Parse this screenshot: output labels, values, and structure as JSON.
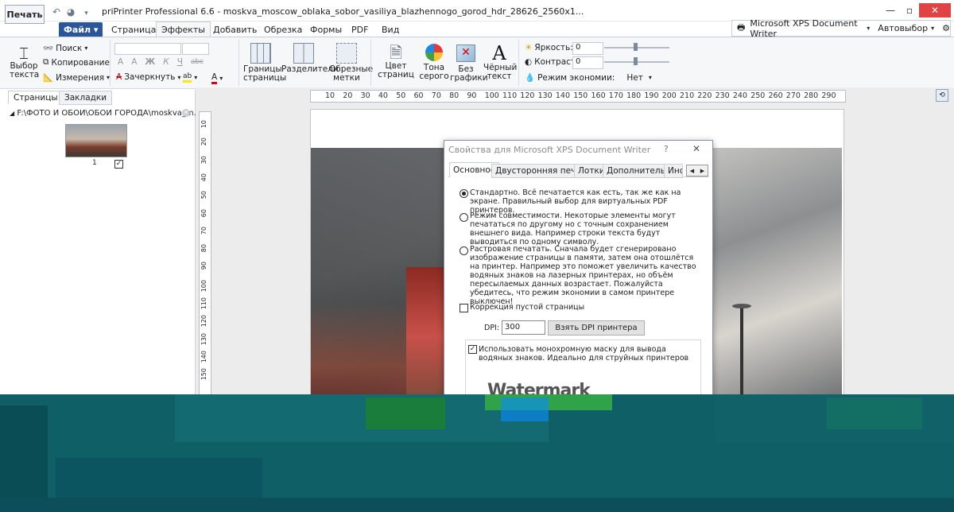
{
  "titlebar": {
    "print_label": "Печать",
    "title": "priPrinter Professional 6.6 - moskva_moscow_oblaka_sobor_vasiliya_blazhennogo_gorod_hdr_28626_2560x1...",
    "qat_icons": [
      "undo-icon",
      "redo-icon",
      "customize-icon"
    ],
    "window_controls": [
      "—",
      "▫",
      "✕"
    ]
  },
  "menu": {
    "file": "Файл ▾",
    "tabs": [
      "Страница",
      "Эффекты",
      "Добавить",
      "Обрезка",
      "Формы",
      "PDF",
      "Вид"
    ],
    "active_index": 1
  },
  "printer": {
    "name": "Microsoft XPS Document Writer",
    "mode": "Автовыбор",
    "gear": "⚙"
  },
  "ribbon": {
    "select_text": "Выбор\nтекста",
    "search": "Поиск",
    "copy": "Копирование",
    "measure": "Измерения",
    "strike": "Зачеркнуть",
    "font_buttons": [
      "A",
      "A",
      "Ж",
      "К",
      "Ч",
      "abc"
    ],
    "page_borders": "Границы\nстраницы",
    "dividers": "Разделители",
    "crop_marks": "Обрезные\nметки",
    "color_pages": "Цвет\nстраниц",
    "grayscale": "Тона\nсерого",
    "no_graphics": "Без\nграфики",
    "black_text": "Чёрный\nтекст",
    "brightness_label": "Яркость:",
    "brightness_value": "0",
    "contrast_label": "Контраст:",
    "contrast_value": "0",
    "economy_label": "Режим экономии:",
    "economy_value": "Нет"
  },
  "left_panel": {
    "tabs": [
      "Страницы",
      "Закладки"
    ],
    "path": "F:\\ФОТО И ОБОИ\\ОБОИ ГОРОДА\\moskva_m...",
    "thumb_number": "1"
  },
  "ruler": {
    "h_ticks": [
      "10",
      "20",
      "30",
      "40",
      "50",
      "60",
      "70",
      "80",
      "90",
      "100",
      "110",
      "120",
      "130",
      "140",
      "150",
      "160",
      "170",
      "180",
      "190",
      "200",
      "210",
      "220",
      "230",
      "240",
      "250",
      "260",
      "270",
      "280",
      "290"
    ],
    "v_ticks": [
      "10",
      "20",
      "30",
      "40",
      "50",
      "60",
      "70",
      "80",
      "90",
      "100",
      "110",
      "120",
      "130",
      "140",
      "150"
    ]
  },
  "dialog": {
    "title": "Свойства для Microsoft XPS Document Writer",
    "help": "?",
    "close": "✕",
    "tabs": [
      "Основное",
      "Двусторонняя печать",
      "Лотки",
      "Дополнительно",
      "Инстр"
    ],
    "opt1": "Стандартно. Всё печатается как есть, так же как на экране. Правильный выбор для виртуальных PDF принтеров.",
    "opt2": "Режим совместимости. Некоторые элементы могут печататься по другому но с точным сохранением внешнего вида. Например строки текста будут выводиться по одному символу.",
    "opt3": "Растровая печатать. Сначала будет сгенерировано изображение страницы в памяти, затем она отошлётся на принтер. Например это поможет увеличить качество водяных знаков на лазерных принтерах, но объём пересылаемых данных возрастает. Пожалуйста убедитесь, что режим экономии в самом принтере выключен!",
    "empty_page": "Коррекция пустой страницы",
    "dpi_label": "DPI:",
    "dpi_value": "300",
    "dpi_button": "Взять DPI принтера",
    "mono_mask": "Использовать монохромную маску для вывода водяных знаков. Идеально для струйных принтеров",
    "watermark": "Watermark"
  },
  "colors": {
    "accent": "#2b579a",
    "overlay": "#0f5f66"
  }
}
